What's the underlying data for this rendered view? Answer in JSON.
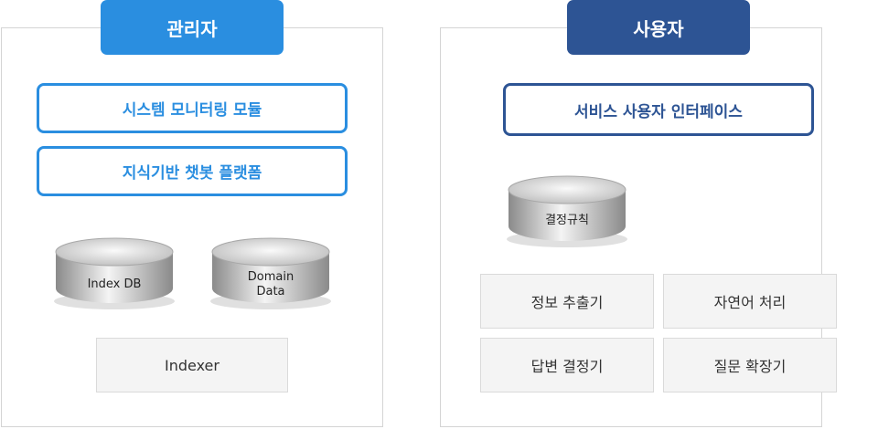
{
  "admin": {
    "tab_label": "관리자",
    "modules": [
      "시스템 모니터링 모듈",
      "지식기반 챗봇 플랫폼"
    ],
    "databases": [
      {
        "line1": "Index DB",
        "line2": ""
      },
      {
        "line1": "Domain",
        "line2": "Data"
      }
    ],
    "indexer_label": "Indexer"
  },
  "user": {
    "tab_label": "사용자",
    "interface_label": "서비스 사용자 인터페이스",
    "rules_db_label": "결정규칙",
    "components": [
      "정보 추출기",
      "자연어 처리",
      "답변 결정기",
      "질문 확장기"
    ]
  },
  "colors": {
    "admin_accent": "#2a8ee0",
    "user_accent": "#2d5494",
    "component_bg": "#f4f4f4",
    "panel_border": "#d4d4d4"
  }
}
